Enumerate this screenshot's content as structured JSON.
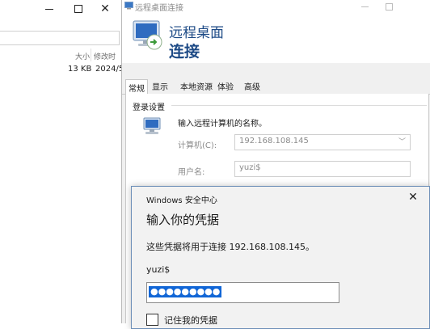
{
  "explorer": {
    "columns": {
      "size": "大小",
      "modified": "修改时",
      "modified_full": "修改时间"
    },
    "file_row": {
      "size": "13 KB",
      "modified": "2024/5"
    }
  },
  "rdp_window": {
    "title": "远程桌面连接",
    "banner": {
      "line1": "远程桌面",
      "line2": "连接"
    },
    "tabs": [
      "常规",
      "显示",
      "本地资源",
      "体验",
      "高级"
    ],
    "logon_settings": {
      "group_title": "登录设置",
      "prompt": "输入远程计算机的名称。",
      "computer_label": "计算机(C):",
      "computer_value": "192.168.108.145",
      "username_label": "用户名:",
      "username_value": "yuzi$"
    }
  },
  "security_dialog": {
    "source": "Windows 安全中心",
    "heading": "输入你的凭据",
    "description": "这些凭据将用于连接 192.168.108.145。",
    "username": "yuzi$",
    "password_mask": "●●●●●●●●●",
    "remember_label": "记住我的凭据",
    "close_glyph": "✕"
  },
  "colors": {
    "banner_text": "#1d4a86",
    "selection": "#1166d6",
    "dialog_border": "#6d8fb8"
  }
}
